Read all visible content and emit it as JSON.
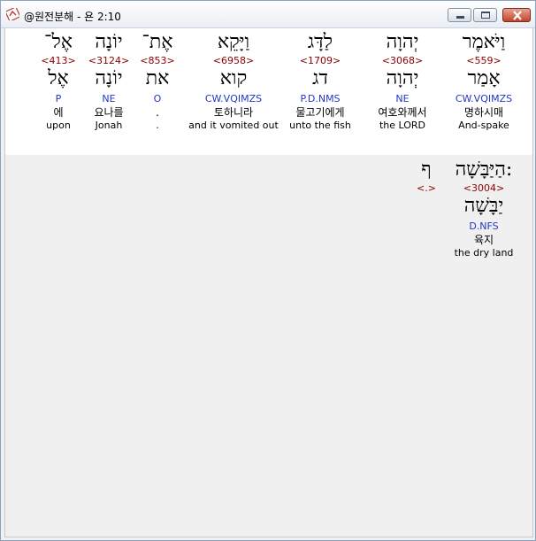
{
  "window": {
    "title": "@원전분해 - 욘 2:10"
  },
  "columns": [
    {
      "hebrew": "וַיֹּאמֶר",
      "strong": "<559>",
      "root": "אָמַר",
      "parse": "CW.VQIMZS",
      "korean": "명하시매",
      "english": "And-spake"
    },
    {
      "hebrew": "יְהוָה",
      "strong": "<3068>",
      "root": "יְהוָה",
      "parse": "NE",
      "korean": "여호와께서",
      "english": "the LORD"
    },
    {
      "hebrew": "לַדָּג",
      "strong": "<1709>",
      "root": "דג",
      "parse": "P.D.NMS",
      "korean": "물고기에게",
      "english": "unto the fish"
    },
    {
      "hebrew": "וַיָּקֵא",
      "strong": "<6958>",
      "root": "קוא",
      "parse": "CW.VQIMZS",
      "korean": "토하니라",
      "english": "and it vomited out"
    },
    {
      "hebrew": "אֶת־",
      "strong": "<853>",
      "root": "את",
      "parse": "O",
      "korean": ".",
      "english": "."
    },
    {
      "hebrew": "יוֹנָה",
      "strong": "<3124>",
      "root": "יוֹנָה",
      "parse": "NE",
      "korean": "요나를",
      "english": "Jonah"
    },
    {
      "hebrew": "אֶל־",
      "strong": "<413>",
      "root": "אֶל",
      "parse": "P",
      "korean": "에",
      "english": "upon"
    }
  ],
  "row2": [
    {
      "hebrew": "הַיַּבָּשָׁה:",
      "strong": "<3004>",
      "root": "יַבָּשָׁה",
      "parse": "D.NFS",
      "korean": "육지",
      "english": "the dry land"
    },
    {
      "hebrew": "ף",
      "strong": "<.>",
      "root": "",
      "parse": "",
      "korean": "",
      "english": ""
    }
  ]
}
